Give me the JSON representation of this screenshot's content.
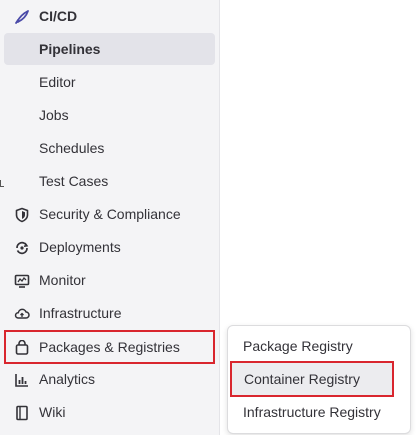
{
  "sidebar": {
    "section_title": "CI/CD",
    "section_icon": "rocket-icon",
    "subitems": [
      {
        "label": "Pipelines",
        "active": true
      },
      {
        "label": "Editor"
      },
      {
        "label": "Jobs"
      },
      {
        "label": "Schedules"
      },
      {
        "label": "Test Cases"
      }
    ],
    "items": [
      {
        "label": "Security & Compliance",
        "icon": "shield-icon"
      },
      {
        "label": "Deployments",
        "icon": "deployments-icon"
      },
      {
        "label": "Monitor",
        "icon": "monitor-icon"
      },
      {
        "label": "Infrastructure",
        "icon": "cloud-icon"
      },
      {
        "label": "Packages & Registries",
        "icon": "package-icon",
        "highlighted": true
      },
      {
        "label": "Analytics",
        "icon": "chart-icon"
      },
      {
        "label": "Wiki",
        "icon": "book-icon"
      }
    ]
  },
  "flyout": {
    "items": [
      {
        "label": "Package Registry"
      },
      {
        "label": "Container Registry",
        "highlighted": true
      },
      {
        "label": "Infrastructure Registry"
      }
    ]
  },
  "colors": {
    "accent_purple": "#4a4aa8",
    "highlight_red": "#d9262e",
    "sidebar_bg": "#f4f4f6"
  }
}
